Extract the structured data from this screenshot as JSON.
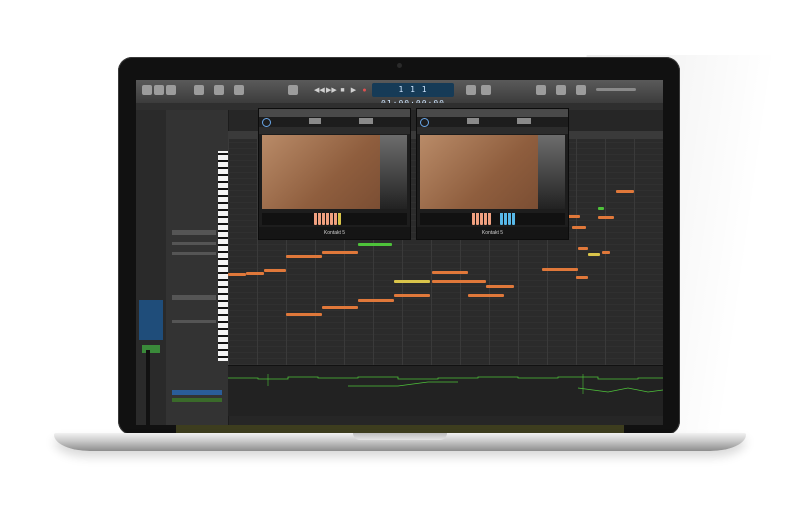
{
  "transport": {
    "lcd_display": "1 1 1 01:00:00:00"
  },
  "plugins": [
    {
      "title": "Kontakt 5"
    },
    {
      "title": "Kontakt 5"
    }
  ],
  "colors": {
    "note_orange": "#e0783a",
    "note_green": "#4ec23a",
    "note_yellow": "#d9c44a",
    "note_red": "#d8553a",
    "lcd_bg": "#163b57",
    "keys_orange": "#f0a080",
    "keys_blue": "#58b8e8"
  },
  "icons": [
    "play-icon",
    "stop-icon",
    "record-icon",
    "rewind-icon",
    "forward-icon",
    "power-icon"
  ]
}
